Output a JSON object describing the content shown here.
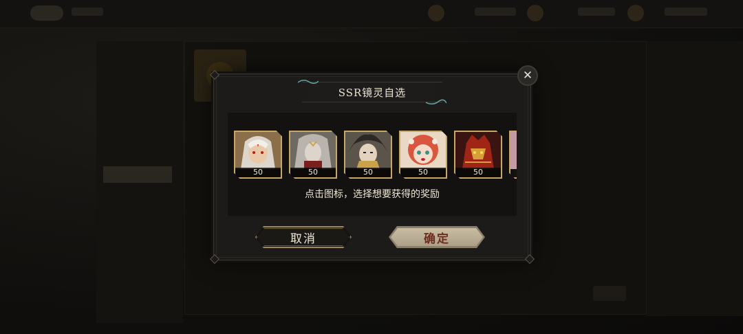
{
  "dialog": {
    "title": "SSR镜灵自选",
    "close_icon": "close-icon",
    "instruction": "点击图标，选择想要获得的奖励",
    "cancel_label": "取消",
    "confirm_label": "确定"
  },
  "rewards": [
    {
      "quantity": "50",
      "theme": "silver-hair-red-eyes",
      "accent": "#c9c2b2"
    },
    {
      "quantity": "50",
      "theme": "grey-hair-dark-robe",
      "accent": "#b7b3ac"
    },
    {
      "quantity": "50",
      "theme": "dark-hair-pale-face",
      "accent": "#4b463f"
    },
    {
      "quantity": "50",
      "theme": "red-hair-girl",
      "accent": "#d9573f"
    },
    {
      "quantity": "50",
      "theme": "red-armor-beast",
      "accent": "#a12516"
    },
    {
      "quantity": "",
      "theme": "pink-partial",
      "accent": "#c39aa5"
    }
  ],
  "colors": {
    "frame_gold": "#c7a866",
    "confirm_text": "#6f2c1e",
    "dialog_bg": "#1c1b19"
  }
}
